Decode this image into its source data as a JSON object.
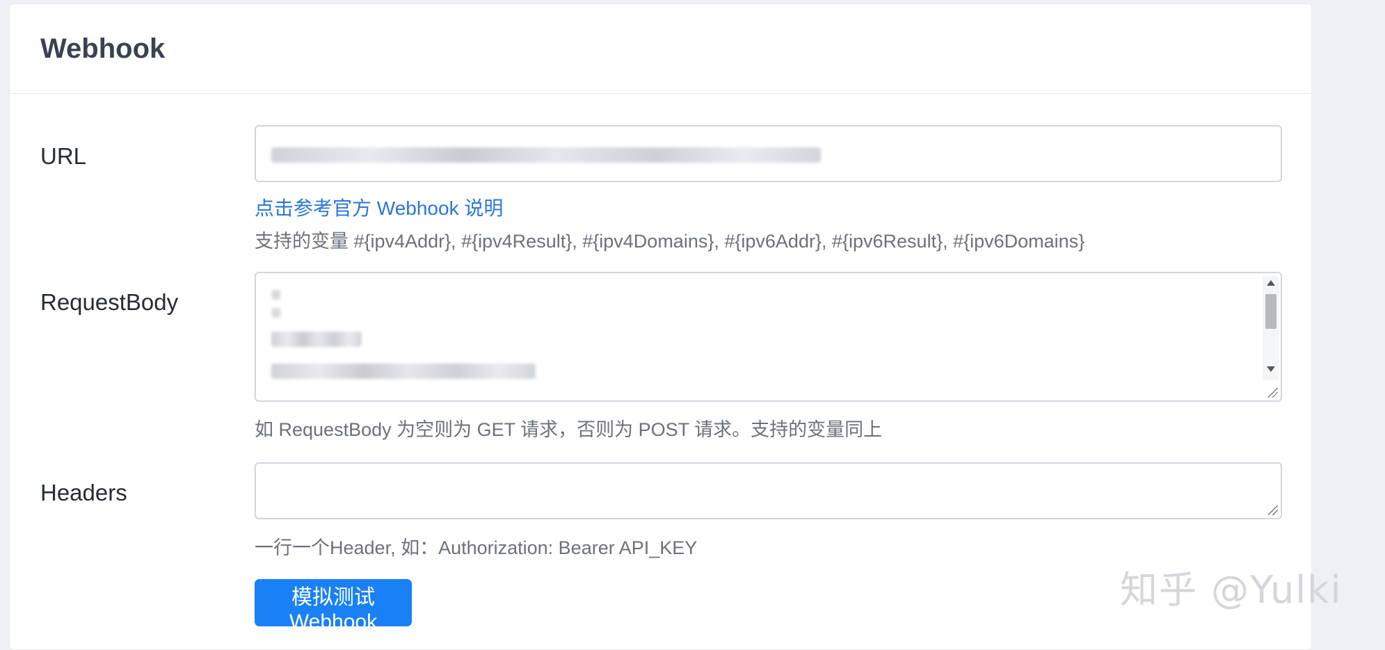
{
  "card": {
    "title": "Webhook"
  },
  "url_field": {
    "label": "URL",
    "help_link": "点击参考官方 Webhook 说明",
    "help_text": "支持的变量 #{ipv4Addr}, #{ipv4Result}, #{ipv4Domains}, #{ipv6Addr}, #{ipv6Result}, #{ipv6Domains}"
  },
  "request_body_field": {
    "label": "RequestBody",
    "help_text": "如 RequestBody 为空则为 GET 请求，否则为 POST 请求。支持的变量同上"
  },
  "headers_field": {
    "label": "Headers",
    "help_text": "一行一个Header, 如：Authorization: Bearer API_KEY"
  },
  "test_button": {
    "label": "模拟测试Webhook"
  },
  "watermark": {
    "text": "知乎 @Yulki"
  },
  "colors": {
    "primary": "#1a80f6",
    "link": "#2b76d6",
    "title": "#3a4152"
  }
}
